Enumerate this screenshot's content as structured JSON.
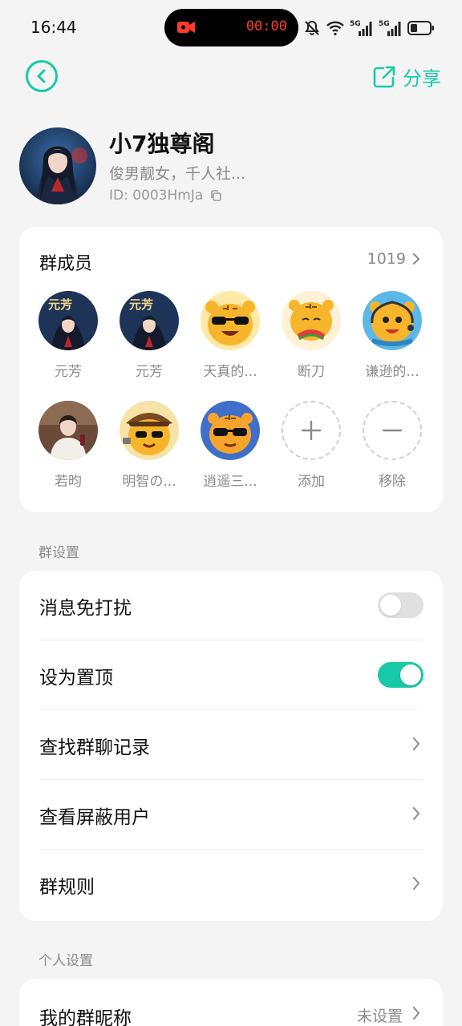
{
  "status_bar": {
    "time": "16:44",
    "recording_time": "00:00",
    "icons": [
      "screen-record-icon",
      "mute-bell-icon",
      "wifi-icon",
      "5g-signal-icon",
      "5g-signal-icon",
      "battery-icon"
    ]
  },
  "header": {
    "back_icon": "back-circle-icon",
    "share_label": "分享",
    "share_icon": "share-icon"
  },
  "group": {
    "name": "小7独尊阁",
    "description": "俊男靓女，千人社...",
    "id_text": "ID: 0003HmJa"
  },
  "members": {
    "title": "群成员",
    "count": "1019",
    "list": [
      {
        "name": "元芳"
      },
      {
        "name": "元芳"
      },
      {
        "name": "天真的..."
      },
      {
        "name": "断刀"
      },
      {
        "name": "谦逊的..."
      },
      {
        "name": "若昀"
      },
      {
        "name": "明智の..."
      },
      {
        "name": "逍遥三..."
      }
    ],
    "add_label": "添加",
    "remove_label": "移除"
  },
  "group_settings": {
    "section_title": "群设置",
    "rows": [
      {
        "label": "消息免打扰",
        "type": "toggle",
        "on": false
      },
      {
        "label": "设为置顶",
        "type": "toggle",
        "on": true
      },
      {
        "label": "查找群聊记录",
        "type": "link"
      },
      {
        "label": "查看屏蔽用户",
        "type": "link"
      },
      {
        "label": "群规则",
        "type": "link"
      }
    ]
  },
  "personal_settings": {
    "section_title": "个人设置",
    "nickname_label": "我的群昵称",
    "nickname_value": "未设置"
  },
  "colors": {
    "accent": "#17c9a7",
    "background": "#f4f4f4",
    "recording_red": "#ff3b30"
  }
}
